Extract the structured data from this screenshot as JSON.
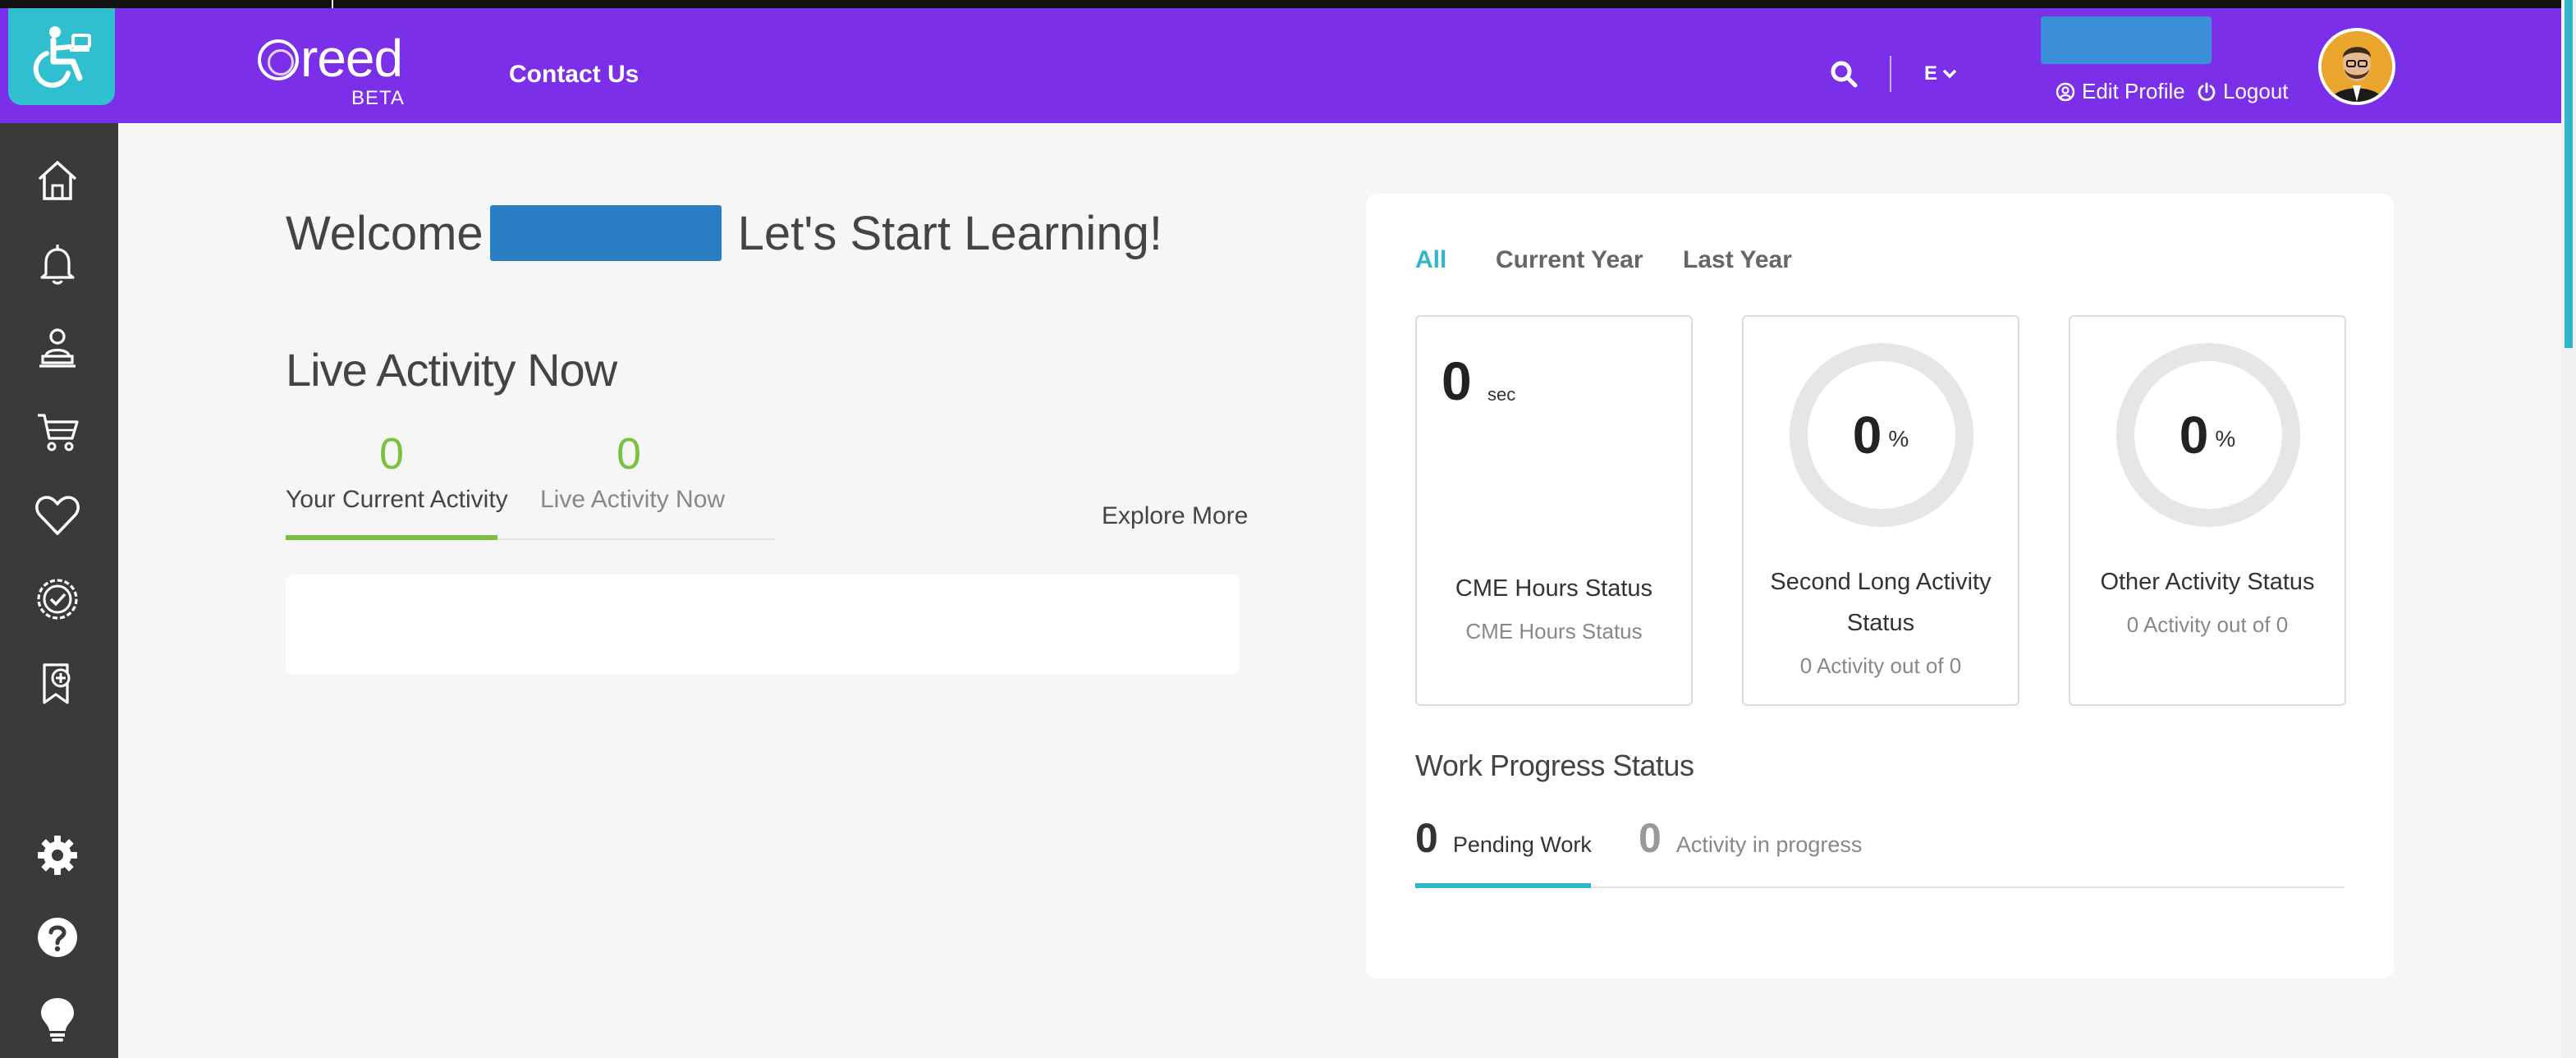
{
  "header": {
    "brand_name": "reed",
    "brand_badge": "BETA",
    "contact_label": "Contact Us",
    "language_label": "E",
    "edit_profile_label": "Edit Profile",
    "logout_label": "Logout",
    "colors": {
      "header_bg": "#7b2fe8",
      "accessibility_bg": "#2fbfcf",
      "accent": "#2fb6c9",
      "green": "#7ac143"
    }
  },
  "sidebar": {
    "items": [
      {
        "icon": "home-icon"
      },
      {
        "icon": "bell-icon"
      },
      {
        "icon": "instructor-icon"
      },
      {
        "icon": "cart-icon"
      },
      {
        "icon": "heart-icon"
      },
      {
        "icon": "badge-check-icon"
      },
      {
        "icon": "bookmark-plus-icon"
      },
      {
        "icon": "gear-icon"
      },
      {
        "icon": "help-icon"
      },
      {
        "icon": "lightbulb-icon"
      }
    ]
  },
  "main": {
    "welcome_prefix": "Welcome",
    "welcome_suffix": "Let's Start Learning!",
    "live_title": "Live Activity Now",
    "tabs": [
      {
        "value": "0",
        "label": "Your Current Activity"
      },
      {
        "value": "0",
        "label": "Live Activity Now"
      }
    ],
    "explore_label": "Explore More"
  },
  "panel": {
    "filters": [
      "All",
      "Current Year",
      "Last Year"
    ],
    "cards": {
      "cme": {
        "value": "0",
        "unit": "sec",
        "title": "CME Hours Status",
        "subtitle": "CME Hours Status"
      },
      "second": {
        "value": "0",
        "unit": "%",
        "title_line1": "Second Long Activity",
        "title_line2": "Status",
        "subtitle": "0 Activity out of 0",
        "percent": 0
      },
      "other": {
        "value": "0",
        "unit": "%",
        "title": "Other Activity Status",
        "subtitle": "0 Activity out of 0",
        "percent": 0
      }
    },
    "work_progress": {
      "title": "Work Progress Status",
      "pending": {
        "value": "0",
        "label": "Pending Work"
      },
      "in_progress": {
        "value": "0",
        "label": "Activity in progress"
      }
    }
  }
}
